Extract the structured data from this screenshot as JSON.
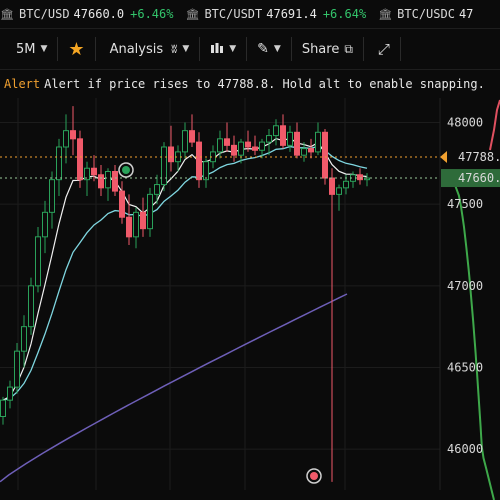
{
  "ticker": [
    {
      "symbol": "BTC/USD",
      "price": "47660.0",
      "change": "+6.46%"
    },
    {
      "symbol": "BTC/USDT",
      "price": "47691.4",
      "change": "+6.64%"
    },
    {
      "symbol": "BTC/USDC",
      "price": "47",
      "change": ""
    }
  ],
  "toolbar": {
    "interval_label": "5M",
    "analysis_label": "Analysis",
    "share_label": "Share"
  },
  "alert": {
    "label": "Alert",
    "message": "Alert if price rises to 47788.8. Hold alt to enable snapping."
  },
  "price_axis": {
    "ticks": [
      "48000",
      "47500",
      "47000",
      "46500",
      "46000"
    ],
    "alert_label": "47788.",
    "current_label": "47660."
  },
  "colors": {
    "up": "#2aa15a",
    "down": "#f05a6a",
    "alert": "#f0a030",
    "ema_fast": "#f0f0f0",
    "ema_slow": "#7fd6e0",
    "ma_long": "#6e5fb8"
  },
  "chart_data": {
    "type": "candlestick",
    "y_range": [
      45750,
      48150
    ],
    "y_ticks": [
      48000,
      47500,
      47000,
      46500,
      46000
    ],
    "alert_price": 47788.8,
    "current_price": 47660.0,
    "candles": [
      [
        46200,
        46320,
        46150,
        46300
      ],
      [
        46300,
        46420,
        46250,
        46380
      ],
      [
        46380,
        46650,
        46340,
        46600
      ],
      [
        46600,
        46820,
        46500,
        46750
      ],
      [
        46750,
        47050,
        46700,
        47000
      ],
      [
        47000,
        47360,
        46960,
        47300
      ],
      [
        47300,
        47520,
        47200,
        47450
      ],
      [
        47450,
        47700,
        47350,
        47650
      ],
      [
        47650,
        47900,
        47550,
        47850
      ],
      [
        47850,
        48050,
        47750,
        47950
      ],
      [
        47950,
        48100,
        47800,
        47900
      ],
      [
        47900,
        47950,
        47600,
        47650
      ],
      [
        47650,
        47760,
        47550,
        47720
      ],
      [
        47720,
        47800,
        47640,
        47680
      ],
      [
        47680,
        47740,
        47550,
        47600
      ],
      [
        47600,
        47720,
        47520,
        47700
      ],
      [
        47700,
        47740,
        47550,
        47580
      ],
      [
        47580,
        47640,
        47380,
        47420
      ],
      [
        47420,
        47560,
        47250,
        47300
      ],
      [
        47300,
        47480,
        47230,
        47450
      ],
      [
        47450,
        47540,
        47300,
        47350
      ],
      [
        47350,
        47600,
        47300,
        47560
      ],
      [
        47560,
        47680,
        47500,
        47620
      ],
      [
        47620,
        47880,
        47580,
        47850
      ],
      [
        47850,
        47980,
        47700,
        47760
      ],
      [
        47760,
        47860,
        47700,
        47820
      ],
      [
        47820,
        48000,
        47780,
        47950
      ],
      [
        47950,
        48050,
        47850,
        47880
      ],
      [
        47880,
        47940,
        47600,
        47650
      ],
      [
        47650,
        47780,
        47600,
        47760
      ],
      [
        47760,
        47860,
        47720,
        47820
      ],
      [
        47820,
        47950,
        47780,
        47900
      ],
      [
        47900,
        48000,
        47820,
        47860
      ],
      [
        47860,
        47920,
        47760,
        47800
      ],
      [
        47800,
        47900,
        47750,
        47880
      ],
      [
        47880,
        47950,
        47820,
        47850
      ],
      [
        47850,
        47920,
        47800,
        47830
      ],
      [
        47830,
        47900,
        47780,
        47880
      ],
      [
        47880,
        47960,
        47800,
        47920
      ],
      [
        47920,
        48020,
        47860,
        47980
      ],
      [
        47980,
        48050,
        47840,
        47860
      ],
      [
        47860,
        47980,
        47820,
        47940
      ],
      [
        47940,
        48000,
        47780,
        47800
      ],
      [
        47800,
        47880,
        47760,
        47840
      ],
      [
        47840,
        47900,
        47780,
        47820
      ],
      [
        47820,
        48000,
        47800,
        47940
      ],
      [
        47940,
        47960,
        47620,
        47660
      ],
      [
        47660,
        47720,
        45800,
        47560
      ],
      [
        47560,
        47620,
        47460,
        47600
      ],
      [
        47600,
        47680,
        47560,
        47640
      ],
      [
        47640,
        47700,
        47600,
        47680
      ],
      [
        47680,
        47720,
        47620,
        47650
      ],
      [
        47650,
        47690,
        47610,
        47660
      ]
    ]
  }
}
